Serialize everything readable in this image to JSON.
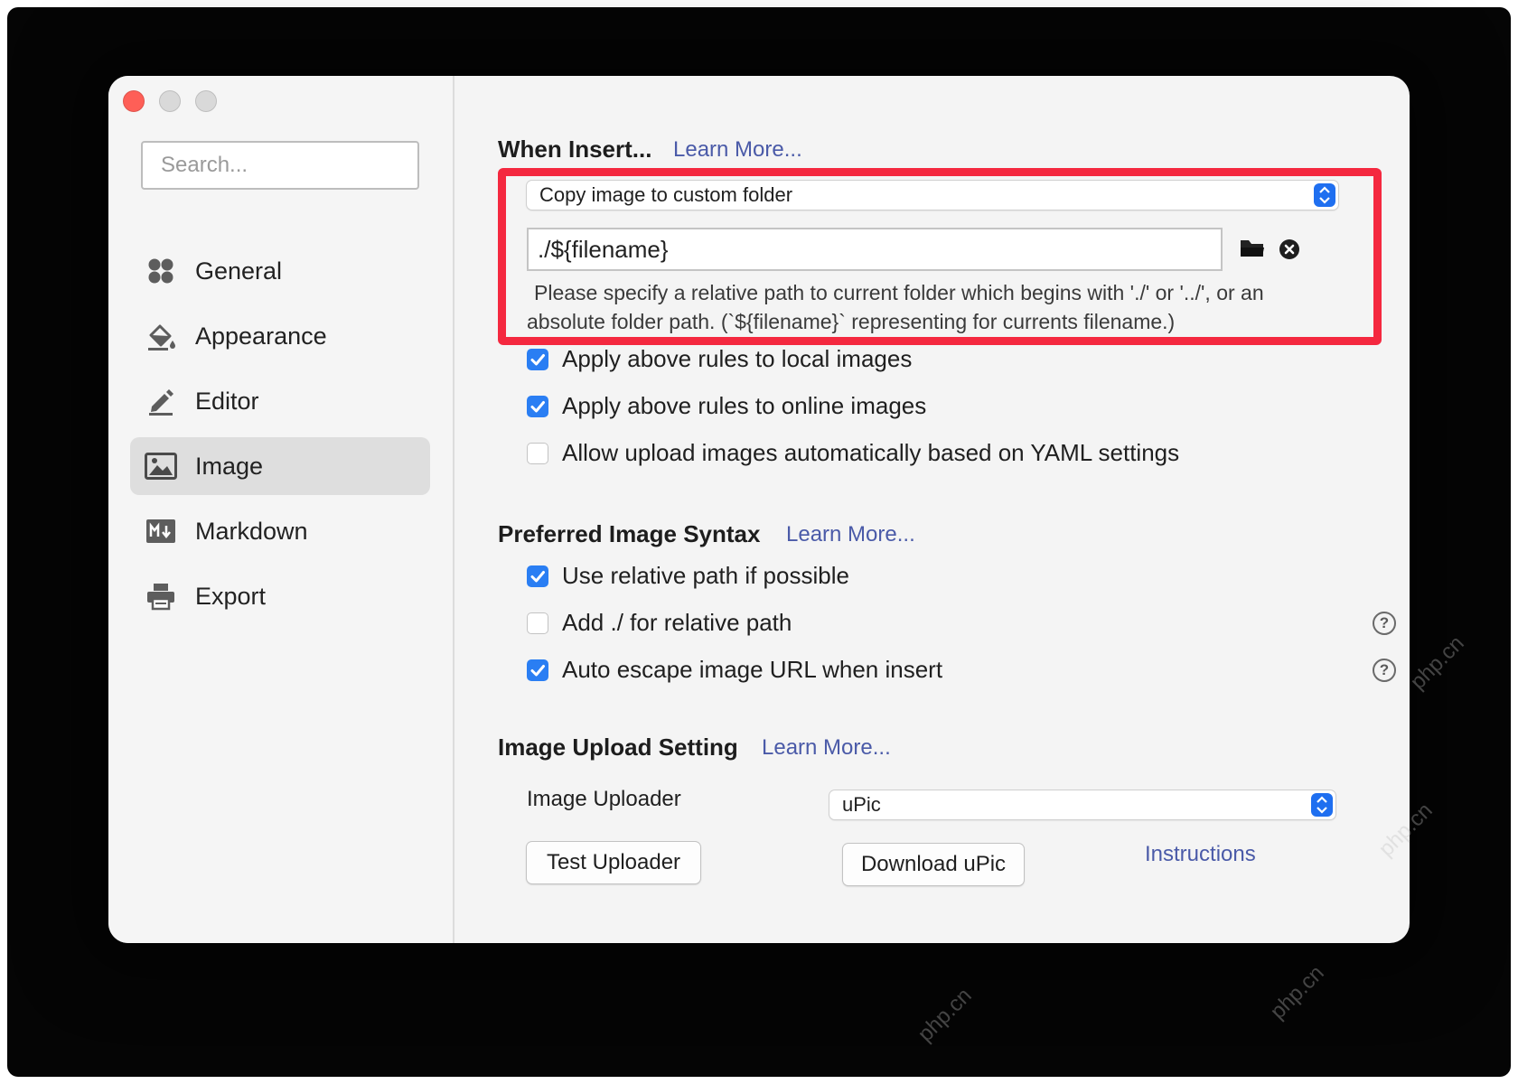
{
  "sidebar": {
    "search_placeholder": "Search...",
    "items": [
      {
        "label": "General",
        "icon": "grid-icon"
      },
      {
        "label": "Appearance",
        "icon": "paint-bucket-icon"
      },
      {
        "label": "Editor",
        "icon": "pencil-icon"
      },
      {
        "label": "Image",
        "icon": "image-icon",
        "active": true
      },
      {
        "label": "Markdown",
        "icon": "markdown-icon"
      },
      {
        "label": "Export",
        "icon": "printer-icon"
      }
    ]
  },
  "when_insert": {
    "title": "When Insert...",
    "learn_more": "Learn More...",
    "action_value": "Copy image to custom folder",
    "path_value": "./${filename}",
    "hint_line1": "Please specify a relative path to current folder which begins with './' or '../', or an",
    "hint_line2": "absolute folder path. (`${filename}` representing for currents filename.)",
    "options": [
      {
        "label": "Apply above rules to local images",
        "checked": true
      },
      {
        "label": "Apply above rules to online images",
        "checked": true
      },
      {
        "label": "Allow upload images automatically based on YAML settings",
        "checked": false
      }
    ]
  },
  "syntax": {
    "title": "Preferred Image Syntax",
    "learn_more": "Learn More...",
    "options": [
      {
        "label": "Use relative path if possible",
        "checked": true
      },
      {
        "label": "Add ./ for relative path",
        "checked": false
      },
      {
        "label": "Auto escape image URL when insert",
        "checked": true
      }
    ],
    "help_glyph": "?"
  },
  "upload": {
    "title": "Image Upload Setting",
    "learn_more": "Learn More...",
    "uploader_label": "Image Uploader",
    "uploader_value": "uPic",
    "test_button": "Test Uploader",
    "download_button": "Download uPic",
    "instructions_link": "Instructions"
  },
  "watermark": "php.cn",
  "colors": {
    "accent": "#2a7ef3",
    "highlight_border": "#f4283f",
    "link": "#4a5aa8",
    "close": "#fe5f57"
  }
}
